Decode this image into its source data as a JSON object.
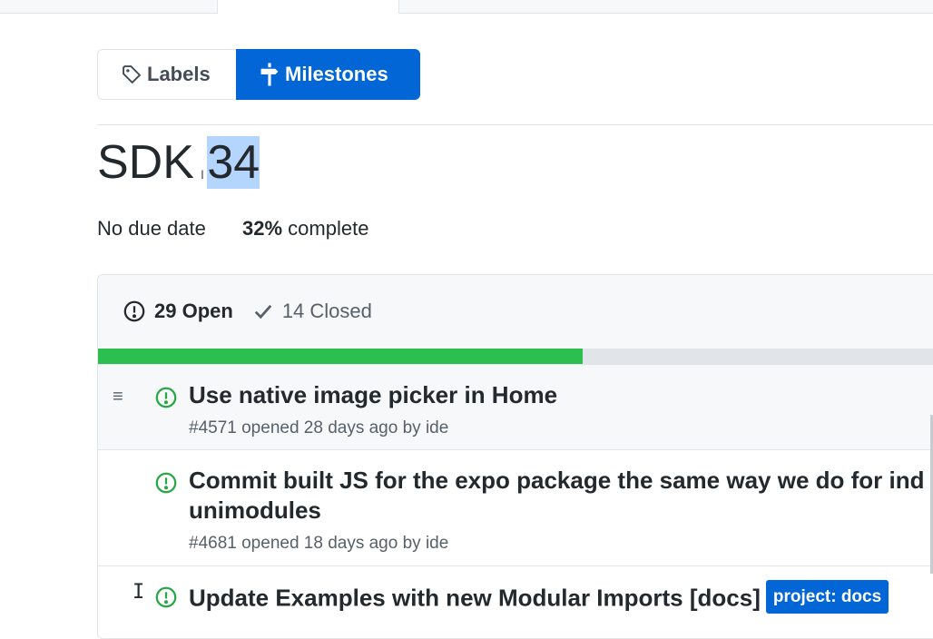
{
  "nav": {
    "labels_label": "Labels",
    "milestones_label": "Milestones"
  },
  "milestone": {
    "title_prefix": "SDK ",
    "title_selected": "34",
    "due": "No due date",
    "percent": "32%",
    "percent_suffix": " complete",
    "progress_fraction": 0.32
  },
  "states": {
    "open_label": "29 Open",
    "closed_label": "14 Closed"
  },
  "issues": [
    {
      "title": "Use native image picker in Home",
      "meta": "#4571 opened 28 days ago by ide"
    },
    {
      "title_line1": "Commit built JS for the expo package the same way we do for ind",
      "title_line2": "unimodules",
      "meta": "#4681 opened 18 days ago by ide"
    },
    {
      "title": "Update Examples with new Modular Imports [docs]",
      "label": "project: docs"
    }
  ],
  "colors": {
    "accent": "#0366d6",
    "open_green": "#28a745",
    "progress_green": "#2cbe4e",
    "selection": "#b4d5fe"
  },
  "icons": {
    "labels": "tag-icon",
    "milestones": "milestone-icon",
    "open": "issue-opened-icon",
    "closed": "check-icon",
    "drag": "drag-handle-icon"
  }
}
